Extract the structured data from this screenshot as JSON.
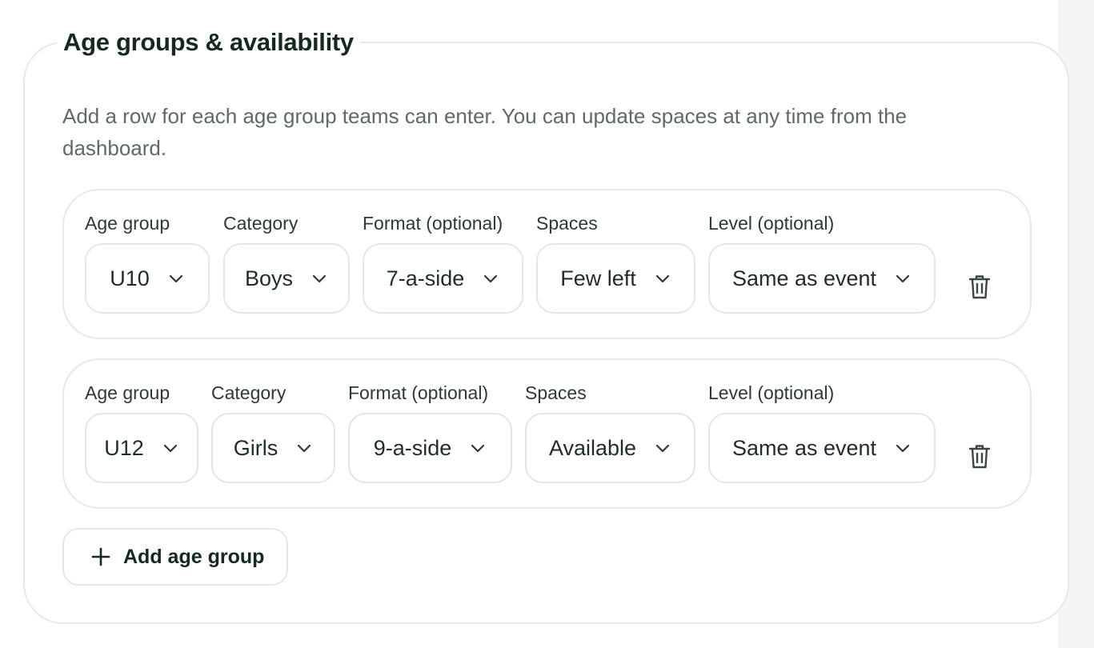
{
  "section": {
    "title": "Age groups & availability",
    "description": "Add a row for each age group teams can enter. You can update spaces at any time from the dashboard."
  },
  "rows": [
    {
      "age_group_label": "Age group",
      "age_group": "U10",
      "category_label": "Category",
      "category": "Boys",
      "format_label": "Format (optional)",
      "format": "7-a-side",
      "spaces_label": "Spaces",
      "spaces": "Few left",
      "level_label": "Level (optional)",
      "level": "Same as event",
      "delete_icon": "trash-icon"
    },
    {
      "age_group_label": "Age group",
      "age_group": "U12",
      "category_label": "Category",
      "category": "Girls",
      "format_label": "Format (optional)",
      "format": "9-a-side",
      "spaces_label": "Spaces",
      "spaces": "Available",
      "level_label": "Level (optional)",
      "level": "Same as event",
      "delete_icon": "trash-icon"
    }
  ],
  "add_button": {
    "label": "Add age group",
    "icon": "plus-icon"
  },
  "colors": {
    "text_dark": "#15291d",
    "text_muted": "#5d6b63",
    "border": "#e5e9e7"
  }
}
